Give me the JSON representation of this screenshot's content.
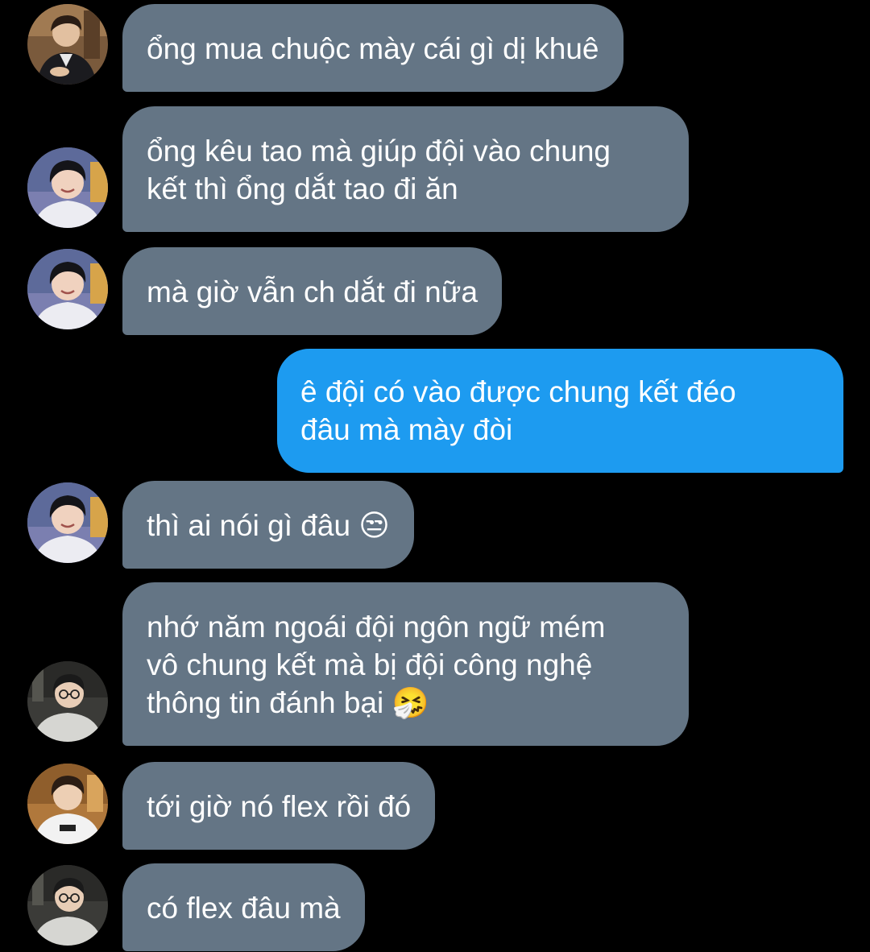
{
  "conversation": {
    "messages": [
      {
        "sender": "them",
        "avatar": "avatar-suit-man",
        "text": "ổng mua chuộc mày cái gì dị khuê"
      },
      {
        "sender": "them",
        "avatar": "avatar-smiling-boy",
        "text": "ổng kêu tao mà giúp đội vào chung\nkết thì ổng dắt tao đi ăn"
      },
      {
        "sender": "them",
        "avatar": "avatar-smiling-boy",
        "text": "mà giờ vẫn ch dắt đi nữa"
      },
      {
        "sender": "me",
        "text": "ê đội có vào được chung kết đéo\nđâu mà mày đòi"
      },
      {
        "sender": "them",
        "avatar": "avatar-smiling-boy",
        "text": "thì ai nói gì đâu 😒"
      },
      {
        "sender": "them",
        "avatar": "avatar-glasses-man",
        "text": "nhớ năm ngoái đội ngôn ngữ mém\nvô chung kết mà bị đội công nghệ\nthông tin đánh bại 🤧"
      },
      {
        "sender": "them",
        "avatar": "avatar-white-hoodie-man",
        "text": "tới giờ nó flex rồi đó"
      },
      {
        "sender": "them",
        "avatar": "avatar-glasses-man",
        "text": "có flex đâu mà"
      }
    ]
  },
  "colors": {
    "background": "#000000",
    "incoming_bubble": "#647585",
    "outgoing_bubble": "#1d9bf0",
    "text": "#ffffff"
  }
}
